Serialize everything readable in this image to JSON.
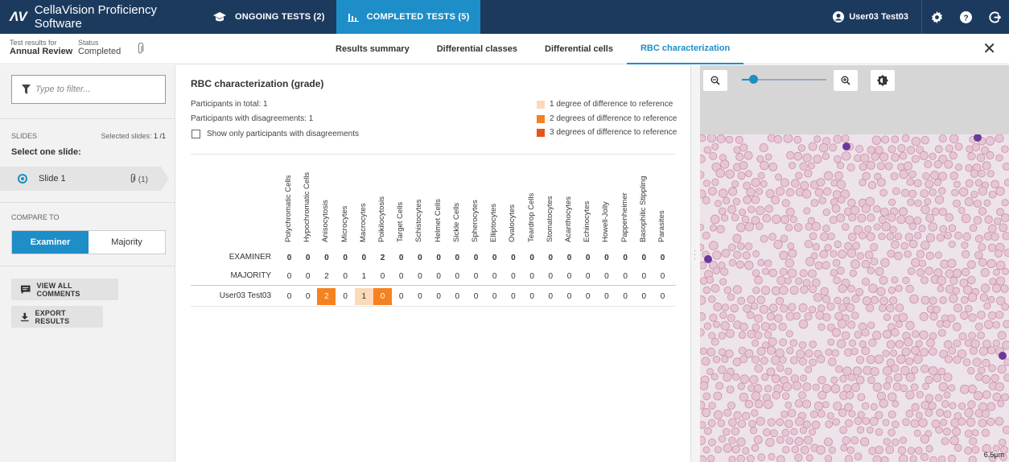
{
  "app": {
    "logo": "ΛV",
    "name": "CellaVision Proficiency Software"
  },
  "nav": {
    "ongoing": "ONGOING TESTS (2)",
    "completed": "COMPLETED TESTS (5)"
  },
  "user": {
    "name": "User03 Test03"
  },
  "subheader": {
    "results_label": "Test results for",
    "results_value": "Annual Review",
    "status_label": "Status",
    "status_value": "Completed"
  },
  "tabs": [
    "Results summary",
    "Differential classes",
    "Differential cells",
    "RBC characterization"
  ],
  "sidebar": {
    "filter_placeholder": "Type to filter...",
    "slides_label": "SLIDES",
    "selected_label": "Selected slides: ",
    "selected_value": "1 /1",
    "select_one": "Select one slide:",
    "slide_name": "Slide 1",
    "slide_attachments": "(1)",
    "compare_label": "COMPARE TO",
    "compare_options": [
      "Examiner",
      "Majority"
    ],
    "view_comments": "VIEW ALL COMMENTS",
    "export_results": "EXPORT RESULTS"
  },
  "main": {
    "title": "RBC characterization (grade)",
    "participants_total": "Participants in total: 1",
    "participants_disagree": "Participants with disagreements: 1",
    "show_only": "Show only participants with disagreements",
    "legend": [
      {
        "label": "1 degree of difference to reference",
        "color": "#fbd9b9"
      },
      {
        "label": "2 degrees of difference to reference",
        "color": "#f58220"
      },
      {
        "label": "3 degrees of difference to reference",
        "color": "#e8541e"
      }
    ]
  },
  "table": {
    "columns": [
      "Polychromatic Cells",
      "Hypochromatic Cells",
      "Anisocytosis",
      "Microcytes",
      "Macrocytes",
      "Poikilocytosis",
      "Target Cells",
      "Schistocytes",
      "Helmet Cells",
      "Sickle Cells",
      "Spherocytes",
      "Elliptocytes",
      "Ovalocytes",
      "Teardrop Cells",
      "Stomatocytes",
      "Acanthocytes",
      "Echinocytes",
      "Howell-Jolly",
      "Pappenheimer",
      "Basophilic Stippling",
      "Parasites"
    ],
    "rows": [
      {
        "label": "EXAMINER",
        "values": [
          "0",
          "0",
          "0",
          "0",
          "0",
          "2",
          "0",
          "0",
          "0",
          "0",
          "0",
          "0",
          "0",
          "0",
          "0",
          "0",
          "0",
          "0",
          "0",
          "0",
          "0"
        ],
        "diff": [
          0,
          0,
          0,
          0,
          0,
          0,
          0,
          0,
          0,
          0,
          0,
          0,
          0,
          0,
          0,
          0,
          0,
          0,
          0,
          0,
          0
        ]
      },
      {
        "label": "MAJORITY",
        "values": [
          "0",
          "0",
          "2",
          "0",
          "1",
          "0",
          "0",
          "0",
          "0",
          "0",
          "0",
          "0",
          "0",
          "0",
          "0",
          "0",
          "0",
          "0",
          "0",
          "0",
          "0"
        ],
        "diff": [
          0,
          0,
          0,
          0,
          0,
          0,
          0,
          0,
          0,
          0,
          0,
          0,
          0,
          0,
          0,
          0,
          0,
          0,
          0,
          0,
          0
        ]
      },
      {
        "label": "User03 Test03",
        "values": [
          "0",
          "0",
          "2",
          "0",
          "1",
          "0",
          "0",
          "0",
          "0",
          "0",
          "0",
          "0",
          "0",
          "0",
          "0",
          "0",
          "0",
          "0",
          "0",
          "0",
          "0"
        ],
        "diff": [
          0,
          0,
          2,
          0,
          1,
          2,
          0,
          0,
          0,
          0,
          0,
          0,
          0,
          0,
          0,
          0,
          0,
          0,
          0,
          0,
          0
        ]
      }
    ]
  },
  "viewer": {
    "scale_label": "6.5µm"
  }
}
